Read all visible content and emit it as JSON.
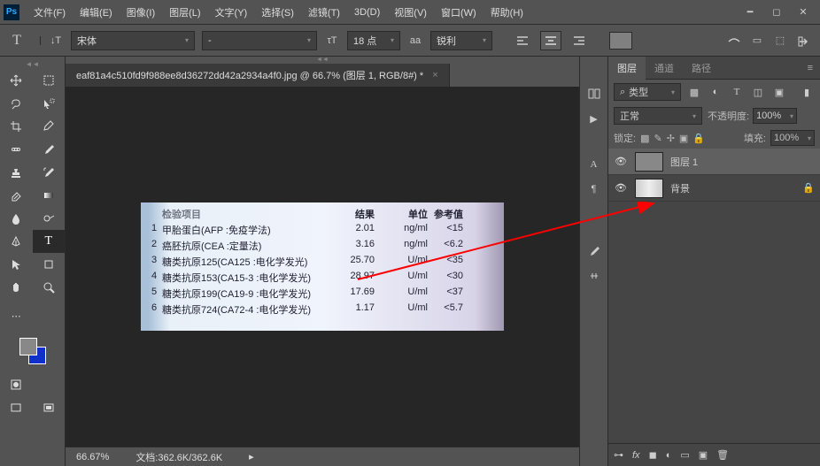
{
  "menu": [
    "文件(F)",
    "编辑(E)",
    "图像(I)",
    "图层(L)",
    "文字(Y)",
    "选择(S)",
    "滤镜(T)",
    "3D(D)",
    "视图(V)",
    "窗口(W)",
    "帮助(H)"
  ],
  "options": {
    "font": "宋体",
    "style": "-",
    "size_label": "18 点",
    "aa": "锐利"
  },
  "doc_tab": "eaf81a4c510fd9f988ee8d36272dd42a2934a4f0.jpg @ 66.7% (图层 1, RGB/8#) *",
  "status": {
    "zoom": "66.67%",
    "doc": "文档:362.6K/362.6K"
  },
  "panel": {
    "tabs": [
      "图层",
      "通道",
      "路径"
    ],
    "filter": "类型",
    "mode": "正常",
    "opacity_label": "不透明度:",
    "opacity": "100%",
    "lock_label": "锁定:",
    "fill_label": "填充:",
    "fill": "100%",
    "layers": [
      {
        "name": "图层 1",
        "selected": true,
        "locked": false
      },
      {
        "name": "背景",
        "selected": false,
        "locked": true
      }
    ]
  },
  "doc_image": {
    "headers": {
      "result": "结果",
      "unit": "单位",
      "ref": "参考值"
    },
    "rows": [
      {
        "n": "1",
        "name": "甲胎蛋白(AFP :免疫学法)",
        "val": "2.01",
        "unit": "ng/ml",
        "ref": "<15"
      },
      {
        "n": "2",
        "name": "癌胚抗原(CEA :定量法)",
        "val": "3.16",
        "unit": "ng/ml",
        "ref": "<6.2"
      },
      {
        "n": "3",
        "name": "糖类抗原125(CA125 :电化学发光)",
        "val": "25.70",
        "unit": "U/ml",
        "ref": "<35"
      },
      {
        "n": "4",
        "name": "糖类抗原153(CA15-3 :电化学发光)",
        "val": "28.97",
        "unit": "U/ml",
        "ref": "<30"
      },
      {
        "n": "5",
        "name": "糖类抗原199(CA19-9 :电化学发光)",
        "val": "17.69",
        "unit": "U/ml",
        "ref": "<37"
      },
      {
        "n": "6",
        "name": "糖类抗原724(CA72-4 :电化学发光)",
        "val": "1.17",
        "unit": "U/ml",
        "ref": "<5.7"
      }
    ]
  }
}
